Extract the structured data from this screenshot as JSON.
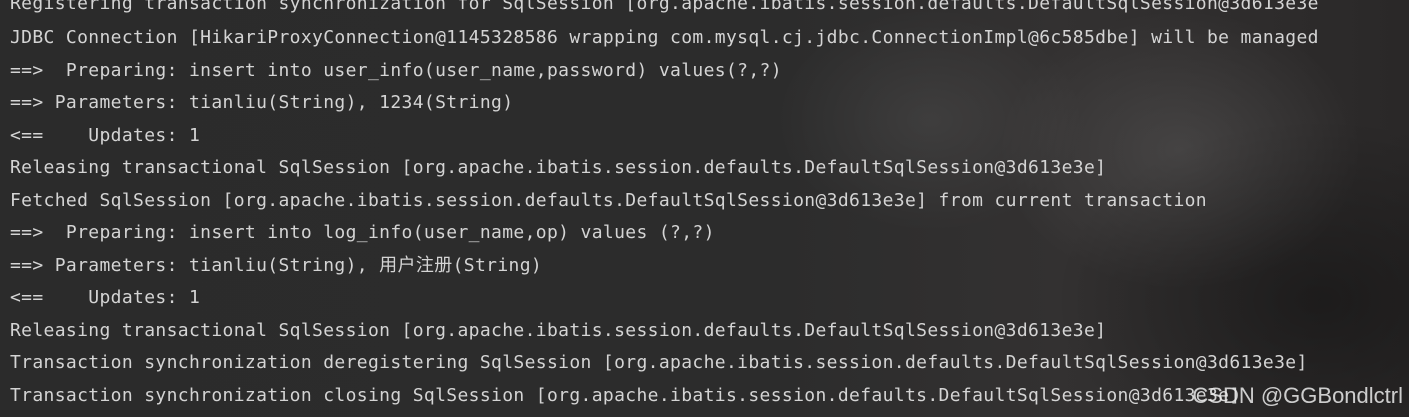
{
  "console": {
    "lines": [
      "Registering transaction synchronization for SqlSession [org.apache.ibatis.session.defaults.DefaultSqlSession@3d613e3e",
      "JDBC Connection [HikariProxyConnection@1145328586 wrapping com.mysql.cj.jdbc.ConnectionImpl@6c585dbe] will be managed",
      "==>  Preparing: insert into user_info(user_name,password) values(?,?)",
      "==> Parameters: tianliu(String), 1234(String)",
      "<==    Updates: 1",
      "Releasing transactional SqlSession [org.apache.ibatis.session.defaults.DefaultSqlSession@3d613e3e]",
      "Fetched SqlSession [org.apache.ibatis.session.defaults.DefaultSqlSession@3d613e3e] from current transaction",
      "==>  Preparing: insert into log_info(user_name,op) values (?,?)",
      "==> Parameters: tianliu(String), 用户注册(String)",
      "<==    Updates: 1",
      "Releasing transactional SqlSession [org.apache.ibatis.session.defaults.DefaultSqlSession@3d613e3e]",
      "Transaction synchronization deregistering SqlSession [org.apache.ibatis.session.defaults.DefaultSqlSession@3d613e3e]",
      "Transaction synchronization closing SqlSession [org.apache.ibatis.session.defaults.DefaultSqlSession@3d613e3e]"
    ],
    "text_color": "#d4d4d4",
    "background_color": "#2b2b2b"
  },
  "watermark": {
    "text": "CSDN @GGBondlctrl"
  }
}
